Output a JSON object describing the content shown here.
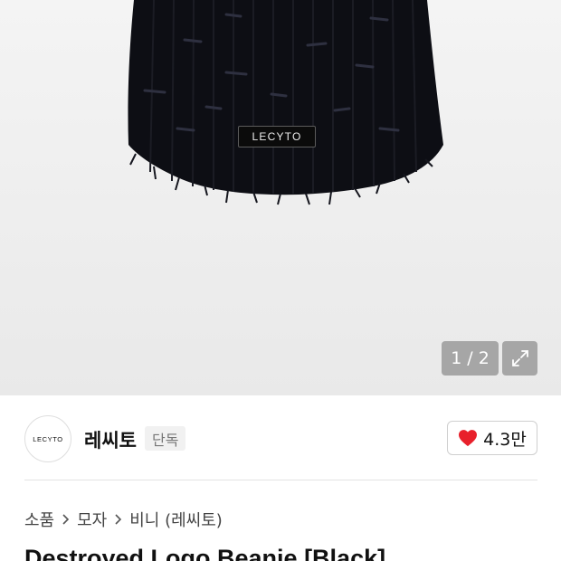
{
  "gallery": {
    "current_page": "1",
    "separator": "/",
    "total_pages": "2",
    "product_tag_label": "LECYTO",
    "expand_icon": "expand-icon"
  },
  "brand": {
    "logo_text": "LECYTO",
    "name": "레씨토",
    "badge": "단독",
    "like_icon": "heart-icon",
    "like_color": "#e8202b",
    "like_count": "4.3만"
  },
  "breadcrumb": {
    "items": [
      "소품",
      "모자",
      "비니 (레씨토)"
    ],
    "separator_icon": "chevron-right-icon"
  },
  "product": {
    "title": "Destroyed Logo Beanie [Black]"
  }
}
